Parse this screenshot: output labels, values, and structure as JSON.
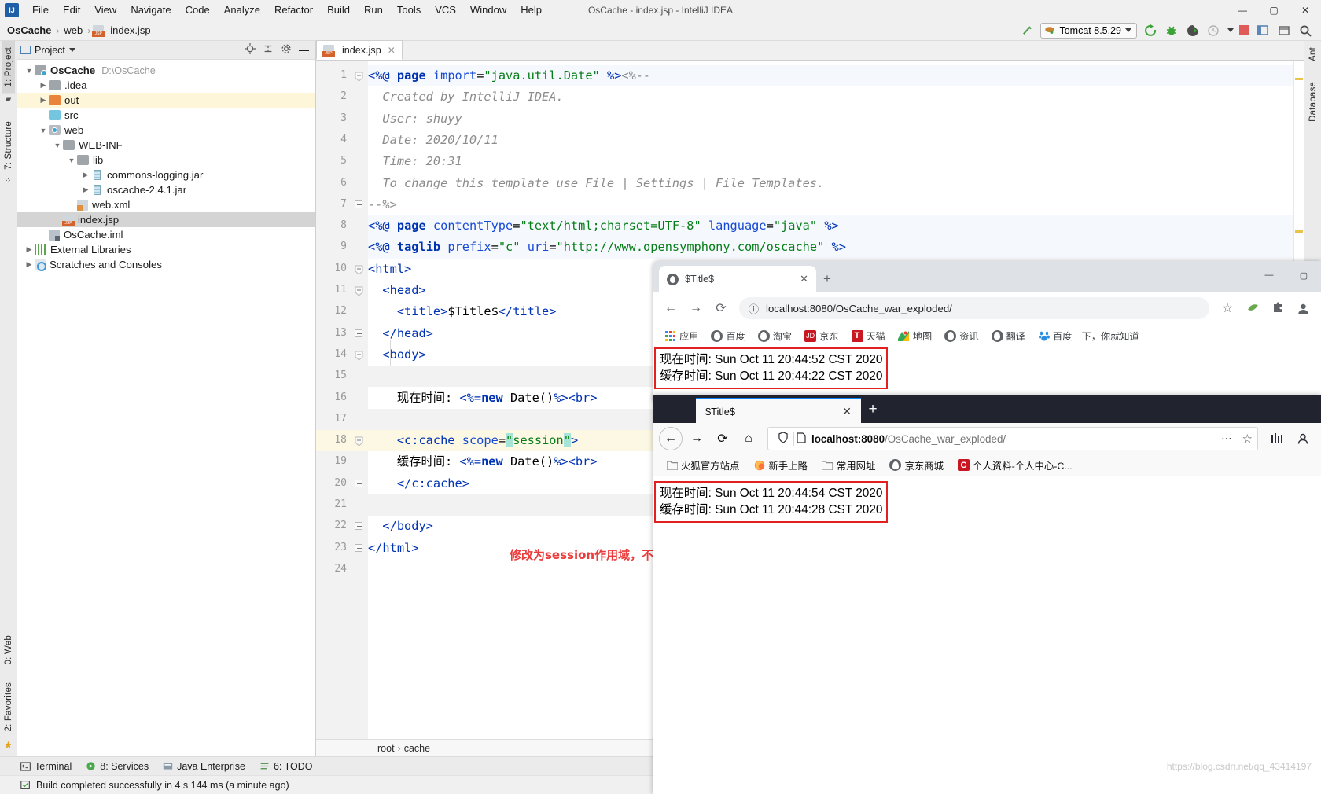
{
  "ide": {
    "window_title": "OsCache - index.jsp - IntelliJ IDEA",
    "logo": "IJ",
    "menus": [
      "File",
      "Edit",
      "View",
      "Navigate",
      "Code",
      "Analyze",
      "Refactor",
      "Build",
      "Run",
      "Tools",
      "VCS",
      "Window",
      "Help"
    ],
    "window_buttons": {
      "minimize": "—",
      "maximize": "▢",
      "close": "✕"
    },
    "breadcrumb": {
      "project": "OsCache",
      "folder": "web",
      "file": "index.jsp",
      "separator": "›"
    },
    "run_config": {
      "name": "Tomcat 8.5.29"
    },
    "project_panel": {
      "title": "Project",
      "tree": [
        {
          "indent": 0,
          "arrow": "▼",
          "icon": "module-folder-icon",
          "name": "OsCache",
          "bold": true,
          "path": "D:\\OsCache",
          "state": "normal"
        },
        {
          "indent": 1,
          "arrow": "▶",
          "icon": "folder-icon",
          "name": ".idea",
          "bold": false,
          "path": "",
          "state": "normal"
        },
        {
          "indent": 1,
          "arrow": "▶",
          "icon": "folder-orange-icon",
          "name": "out",
          "bold": false,
          "path": "",
          "state": "highlight"
        },
        {
          "indent": 1,
          "arrow": "",
          "icon": "folder-cyan-icon",
          "name": "src",
          "bold": false,
          "path": "",
          "state": "normal"
        },
        {
          "indent": 1,
          "arrow": "▼",
          "icon": "web-folder-icon",
          "name": "web",
          "bold": false,
          "path": "",
          "state": "normal"
        },
        {
          "indent": 2,
          "arrow": "▼",
          "icon": "folder-icon",
          "name": "WEB-INF",
          "bold": false,
          "path": "",
          "state": "normal"
        },
        {
          "indent": 3,
          "arrow": "▼",
          "icon": "folder-icon",
          "name": "lib",
          "bold": false,
          "path": "",
          "state": "normal"
        },
        {
          "indent": 4,
          "arrow": "▶",
          "icon": "jar-icon",
          "name": "commons-logging.jar",
          "bold": false,
          "path": "",
          "state": "normal"
        },
        {
          "indent": 4,
          "arrow": "▶",
          "icon": "jar-icon",
          "name": "oscache-2.4.1.jar",
          "bold": false,
          "path": "",
          "state": "normal"
        },
        {
          "indent": 3,
          "arrow": "",
          "icon": "xml-file-icon",
          "name": "web.xml",
          "bold": false,
          "path": "",
          "state": "normal"
        },
        {
          "indent": 2,
          "arrow": "",
          "icon": "jsp-file-icon",
          "name": "index.jsp",
          "bold": false,
          "path": "",
          "state": "selected"
        },
        {
          "indent": 1,
          "arrow": "",
          "icon": "iml-file-icon",
          "name": "OsCache.iml",
          "bold": false,
          "path": "",
          "state": "normal"
        },
        {
          "indent": 0,
          "arrow": "▶",
          "icon": "external-libraries-icon",
          "name": "External Libraries",
          "bold": false,
          "path": "",
          "state": "normal"
        },
        {
          "indent": 0,
          "arrow": "▶",
          "icon": "scratches-icon",
          "name": "Scratches and Consoles",
          "bold": false,
          "path": "",
          "state": "normal"
        }
      ]
    },
    "left_rail": {
      "top": [
        "1: Project",
        "7: Structure"
      ],
      "bottom": [
        "0: Web",
        "2: Favorites"
      ]
    },
    "right_rail": [
      "Ant",
      "Database"
    ],
    "editor": {
      "tab": {
        "label": "index.jsp",
        "close": "✕"
      },
      "line_count": 24,
      "breadcrumb": {
        "root": "root",
        "sep": "›",
        "child": "cache"
      },
      "scope_highlight": "session"
    },
    "bottom_tools": [
      {
        "label": "Terminal",
        "icon": "terminal-icon"
      },
      {
        "label": "8: Services",
        "icon": "services-icon"
      },
      {
        "label": "Java Enterprise",
        "icon": "java-enterprise-icon"
      },
      {
        "label": "6: TODO",
        "icon": "todo-icon"
      }
    ],
    "status_message": "Build completed successfully in 4 s 144 ms (a minute ago)"
  },
  "code_lines": [
    {
      "n": 1,
      "bg": "jsp",
      "fold": "tri-open",
      "html": "<span class='tag'>&lt;%@</span> <span class='k'>page</span> <span class='attr'>import</span>=<span class='str'>\"java.util.Date\"</span> <span class='tag'>%&gt;</span><span class='cmt'>&lt;%--</span>"
    },
    {
      "n": 2,
      "bg": "none",
      "fold": "",
      "html": "  <span class='cmt'>Created by IntelliJ IDEA.</span>"
    },
    {
      "n": 3,
      "bg": "none",
      "fold": "",
      "html": "  <span class='cmt'>User: shuyy</span>"
    },
    {
      "n": 4,
      "bg": "none",
      "fold": "",
      "html": "  <span class='cmt'>Date: 2020/10/11</span>"
    },
    {
      "n": 5,
      "bg": "none",
      "fold": "",
      "html": "  <span class='cmt'>Time: 20:31</span>"
    },
    {
      "n": 6,
      "bg": "none",
      "fold": "",
      "html": "  <span class='cmt'>To change this template use File | Settings | File Templates.</span>"
    },
    {
      "n": 7,
      "bg": "none",
      "fold": "box",
      "html": "<span class='cmt'>--%&gt;</span>"
    },
    {
      "n": 8,
      "bg": "jsp",
      "fold": "",
      "html": "<span class='tag'>&lt;%@</span> <span class='k'>page</span> <span class='attr'>contentType</span>=<span class='str'>\"text/html;charset=UTF-8\"</span> <span class='attr'>language</span>=<span class='str'>\"java\"</span> <span class='tag'>%&gt;</span>"
    },
    {
      "n": 9,
      "bg": "jsp",
      "fold": "",
      "html": "<span class='tag'>&lt;%@</span> <span class='k'>taglib</span> <span class='attr'>prefix</span>=<span class='str'>\"c\"</span> <span class='attr'>uri</span>=<span class='str'>\"http://www.opensymphony.com/oscache\"</span> <span class='tag'>%&gt;</span>"
    },
    {
      "n": 10,
      "bg": "none",
      "fold": "tri-open",
      "html": "<span class='tag'>&lt;html&gt;</span>"
    },
    {
      "n": 11,
      "bg": "none",
      "fold": "tri-open",
      "html": "  <span class='tag'>&lt;head&gt;</span>"
    },
    {
      "n": 12,
      "bg": "none",
      "fold": "",
      "html": "    <span class='tag'>&lt;title&gt;</span><span class='txt'>$Title$</span><span class='tag'>&lt;/title&gt;</span>"
    },
    {
      "n": 13,
      "bg": "none",
      "fold": "box",
      "html": "  <span class='tag'>&lt;/head&gt;</span>"
    },
    {
      "n": 14,
      "bg": "none",
      "fold": "tri-open",
      "html": "  <span class='tag'>&lt;body&gt;</span>"
    },
    {
      "n": 15,
      "bg": "gray",
      "fold": "",
      "html": ""
    },
    {
      "n": 16,
      "bg": "none",
      "fold": "",
      "html": "    <span class='txt'>现在时间: </span><span class='tag'>&lt;%=</span><span class='k'>new</span> <span class='txt'>Date()</span><span class='tag'>%&gt;&lt;br&gt;</span>"
    },
    {
      "n": 17,
      "bg": "gray",
      "fold": "",
      "html": ""
    },
    {
      "n": 18,
      "bg": "caret",
      "fold": "tri-open",
      "html": "    <span class='tag'>&lt;c:cache</span> <span class='attr'>scope</span>=<span class='sel-hl str'>\"</span><span class='str'>session</span><span class='sel-hl str'>\"</span><span class='tag'>&gt;</span>"
    },
    {
      "n": 19,
      "bg": "none",
      "fold": "",
      "html": "    <span class='txt'>缓存时间: </span><span class='tag'>&lt;%=</span><span class='k'>new</span> <span class='txt'>Date()</span><span class='tag'>%&gt;&lt;br&gt;</span>"
    },
    {
      "n": 20,
      "bg": "none",
      "fold": "box",
      "html": "    <span class='tag'>&lt;/c:cache&gt;</span>"
    },
    {
      "n": 21,
      "bg": "gray",
      "fold": "",
      "html": ""
    },
    {
      "n": 22,
      "bg": "none",
      "fold": "box",
      "html": "  <span class='tag'>&lt;/body&gt;</span>"
    },
    {
      "n": 23,
      "bg": "none",
      "fold": "box",
      "html": "<span class='tag'>&lt;/html&gt;</span>"
    },
    {
      "n": 24,
      "bg": "none",
      "fold": "",
      "html": ""
    }
  ],
  "annotation": {
    "text": "修改为session作用域，不同浏览器访问时，缓存时间是不一样的",
    "color": "#ec3b3b"
  },
  "chrome": {
    "tab_title": "$Title$",
    "tab_close": "✕",
    "new_tab": "+",
    "window_buttons": {
      "minimize": "—",
      "maximize": "▢"
    },
    "nav": {
      "back": "←",
      "forward": "→",
      "reload": "⟳"
    },
    "url": "localhost:8080/OsCache_war_exploded/",
    "info_icon": "ⓘ",
    "star": "☆",
    "bookmarks": [
      {
        "label": "应用",
        "icon": "apps-grid-icon"
      },
      {
        "label": "百度",
        "icon": "globe-icon"
      },
      {
        "label": "淘宝",
        "icon": "globe-icon"
      },
      {
        "label": "京东",
        "icon": "jd-icon"
      },
      {
        "label": "天猫",
        "icon": "tmall-icon"
      },
      {
        "label": "地图",
        "icon": "map-icon"
      },
      {
        "label": "资讯",
        "icon": "globe-icon"
      },
      {
        "label": "翻译",
        "icon": "globe-icon"
      },
      {
        "label": "百度一下，你就知道",
        "icon": "baidu-paw-icon"
      }
    ],
    "page": {
      "line1_label": "现在时间:",
      "line1_value": "Sun Oct 11 20:44:52 CST 2020",
      "line2_label": "缓存时间:",
      "line2_value": "Sun Oct 11 20:44:22 CST 2020"
    }
  },
  "firefox": {
    "tab_title": "$Title$",
    "tab_close": "✕",
    "new_tab": "+",
    "nav": {
      "back": "←",
      "forward": "→",
      "reload": "⟳",
      "home": "⌂"
    },
    "url_host": "localhost:8080",
    "url_path": "/OsCache_war_exploded/",
    "shield_icon": "shield-icon",
    "page_icon": "page-icon",
    "menu_dots": "⋯",
    "star": "☆",
    "library_icon": "library-icon",
    "account_icon": "account-icon",
    "bookmarks": [
      {
        "label": "火狐官方站点",
        "icon": "folder-icon"
      },
      {
        "label": "新手上路",
        "icon": "firefox-icon"
      },
      {
        "label": "常用网址",
        "icon": "folder-icon"
      },
      {
        "label": "京东商城",
        "icon": "globe-icon"
      },
      {
        "label": "个人资料-个人中心-C...",
        "icon": "csdn-icon"
      }
    ],
    "page": {
      "line1_label": "现在时间:",
      "line1_value": "Sun Oct 11 20:44:54 CST 2020",
      "line2_label": "缓存时间:",
      "line2_value": "Sun Oct 11 20:44:28 CST 2020"
    }
  },
  "watermark": "https://blog.csdn.net/qq_43414197"
}
